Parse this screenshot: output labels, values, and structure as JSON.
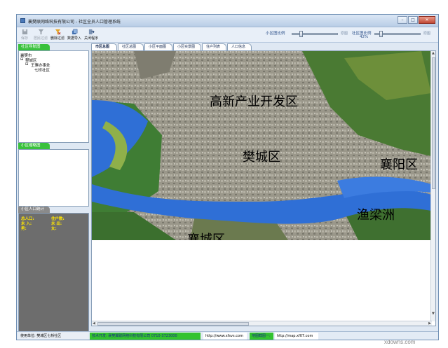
{
  "window": {
    "title": "襄樊联网络科技有限公司 - 社区全员人口管理系统"
  },
  "window_controls": {
    "minimize": "–",
    "maximize": "□",
    "close": "✕"
  },
  "toolbar": {
    "buttons": [
      {
        "label": "保存",
        "icon": "save-icon",
        "enabled": false
      },
      {
        "label": "居民过滤",
        "icon": "filter-icon",
        "enabled": false
      },
      {
        "label": "删除过滤",
        "icon": "clear-filter-icon",
        "enabled": true
      },
      {
        "label": "数据导入",
        "icon": "import-icon",
        "enabled": true
      },
      {
        "label": "关闭程序",
        "icon": "exit-icon",
        "enabled": true
      }
    ],
    "community_scale": {
      "label": "小区图比例",
      "value": "",
      "end_label": "原图"
    },
    "society_scale": {
      "label": "社区图比例",
      "value": "42%",
      "end_label": "原图"
    }
  },
  "left": {
    "community_tree": {
      "header": "社区导航图",
      "items": [
        "襄樊市",
        "樊城区",
        "王寨办事处",
        "七桥社区"
      ]
    },
    "community_map": {
      "header": "小区缩略图"
    },
    "stats": {
      "header": "小区人口统计",
      "rows": [
        {
          "label": "总人口:",
          "label2": "住户数:"
        },
        {
          "label": "未 入:",
          "label2": "未 出:"
        },
        {
          "label": "男:",
          "label2": "女:"
        }
      ]
    }
  },
  "tabs": [
    "市区总图",
    "社区总图",
    "小区平面图",
    "小区实景图",
    "住户列表",
    "人口信息"
  ],
  "active_tab": 0,
  "map": {
    "labels": [
      {
        "text": "高新产业开发区"
      },
      {
        "text": "樊城区"
      },
      {
        "text": "襄阳区"
      },
      {
        "text": "渔梁洲"
      },
      {
        "text": "襄城区"
      }
    ],
    "colors": {
      "river": "#2f6fd6",
      "urban": "#9c9a8e",
      "green": "#3f7d34"
    }
  },
  "statusbar": {
    "user": "使用单位: 樊城区七桥社区",
    "support": "技术开发: 襄樊翼联网络科技有限公司 0710-3723000",
    "url1": "http://www.xfsvs.com",
    "map_label": "地图截图一:",
    "url2": "http://map.xf07.com"
  },
  "watermark": "xdowns.com"
}
